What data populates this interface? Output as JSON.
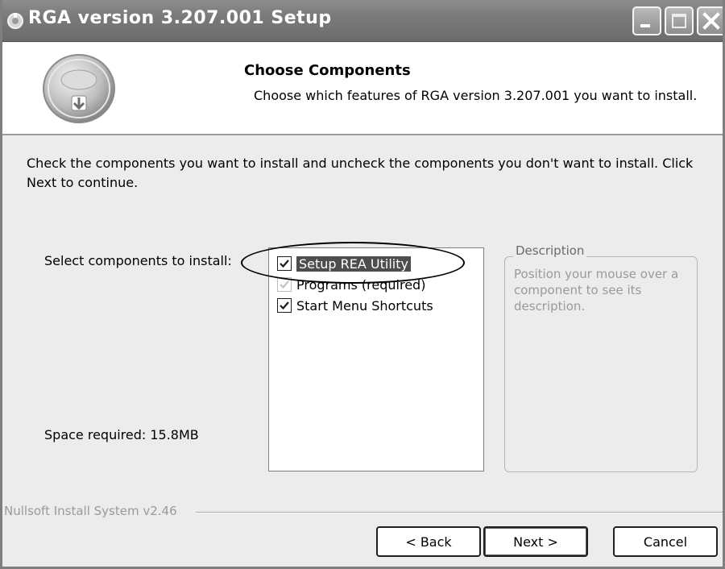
{
  "window": {
    "title": "RGA version 3.207.001 Setup"
  },
  "header": {
    "title": "Choose Components",
    "subtitle": "Choose which features of RGA version 3.207.001 you want to install."
  },
  "body": {
    "instructions": "Check the components you want to install and uncheck the components you don't want to install. Click Next to continue.",
    "select_label": "Select components to install:",
    "space_required": "Space required: 15.8MB",
    "components": [
      {
        "label": "Setup REA Utility",
        "checked": true,
        "selected": true,
        "disabled": false
      },
      {
        "label": "Programs (required)",
        "checked": true,
        "selected": false,
        "disabled": true
      },
      {
        "label": "Start Menu Shortcuts",
        "checked": true,
        "selected": false,
        "disabled": false
      }
    ],
    "description": {
      "legend": "Description",
      "text": "Position your mouse over a component to see its description."
    }
  },
  "footer": {
    "branding": "Nullsoft Install System v2.46",
    "back_label": "< Back",
    "next_label": "Next >",
    "cancel_label": "Cancel"
  },
  "icons": {
    "title": "installer-icon",
    "header": "installer-disk-icon"
  },
  "colors": {
    "titlebar": "#7a7a7a",
    "selection": "#4d4d4d",
    "dialog_bg": "#ececec"
  }
}
